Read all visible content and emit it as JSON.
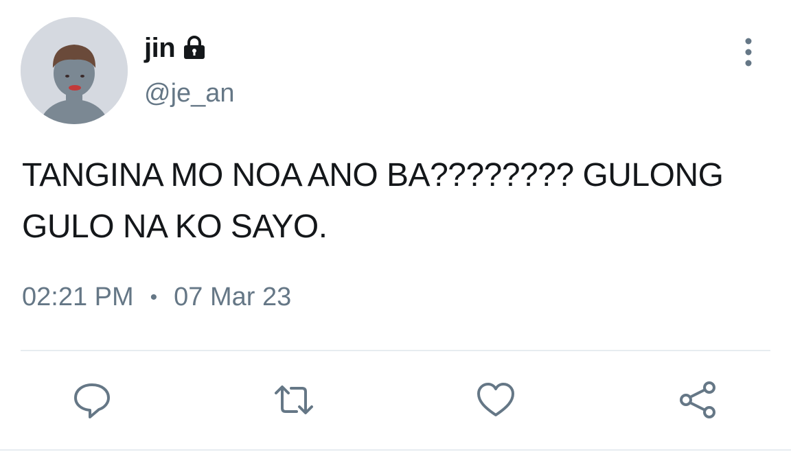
{
  "tweet": {
    "display_name": "jin",
    "handle": "@je_an",
    "text": "TANGINA MO NOA ANO BA???????? GULONG GULO NA KO SAYO.",
    "time": "02:21 PM",
    "separator": "•",
    "date": "07 Mar 23",
    "is_protected": true
  },
  "icons": {
    "lock": "lock-icon",
    "more": "more-vertical-icon",
    "reply": "reply-icon",
    "retweet": "retweet-icon",
    "like": "heart-icon",
    "share": "share-icon"
  },
  "colors": {
    "text_primary": "#14171a",
    "text_secondary": "#657786",
    "icon_gray": "#657786",
    "divider": "#e6ecf0",
    "avatar_bg": "#d5d9e0"
  }
}
